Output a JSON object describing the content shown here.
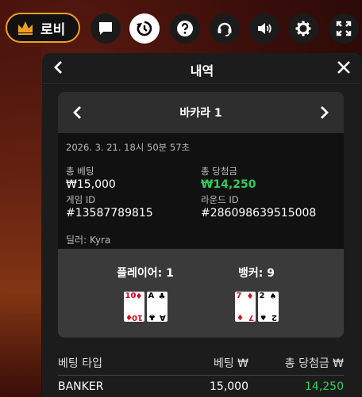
{
  "topbar": {
    "lobby_label": "로비",
    "icons": [
      "chat-icon",
      "history-icon",
      "help-icon",
      "support-headset-icon",
      "volume-icon",
      "settings-gear-icon",
      "fullscreen-icon"
    ]
  },
  "panel": {
    "title": "내역",
    "card": {
      "game_name": "바카라 1",
      "datetime": "2026. 3. 21. 18시 50분 57초",
      "total_bet_label": "총 베팅",
      "total_bet_value": "₩15,000",
      "total_win_label": "총 당첨금",
      "total_win_value": "₩14,250",
      "game_id_label": "게임 ID",
      "game_id_value": "#13587789815",
      "round_id_label": "라운드 ID",
      "round_id_value": "#286098639515008",
      "dealer_text": "딜러: Kyra",
      "player_header": "플레이어: 1",
      "banker_header": "뱅커: 9",
      "player_cards": [
        {
          "rank": "10",
          "suit": "♦",
          "color": "#e0001b"
        },
        {
          "rank": "A",
          "suit": "♣",
          "color": "#000000"
        }
      ],
      "banker_cards": [
        {
          "rank": "7",
          "suit": "♦",
          "color": "#e0001b"
        },
        {
          "rank": "2",
          "suit": "♠",
          "color": "#000000"
        }
      ]
    },
    "bets_table": {
      "headers": [
        "베팅 타입",
        "베팅 ₩",
        "총 당첨금 ₩"
      ],
      "rows": [
        {
          "type": "BANKER",
          "bet": "15,000",
          "win": "14,250"
        }
      ]
    }
  },
  "colors": {
    "accent": "#f0a020",
    "win": "#2ecc5a"
  }
}
